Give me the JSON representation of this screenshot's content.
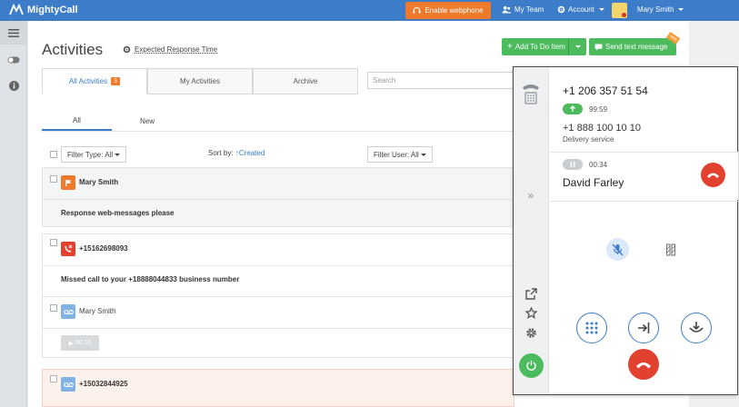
{
  "app": {
    "name": "MightyCall"
  },
  "topbar": {
    "webphone_label": "Enable webphone",
    "my_team_label": "My Team",
    "account_label": "Account",
    "user_name": "Mary Smith"
  },
  "page": {
    "title": "Activities",
    "expected_response_label": "Expected Response Time"
  },
  "actions": {
    "add_todo_label": "Add To Do Item",
    "send_text_label": "Send text message",
    "new_tag": "new"
  },
  "tabs": [
    {
      "label": "All Activities",
      "badge": "3"
    },
    {
      "label": "My Activities"
    },
    {
      "label": "Archive"
    }
  ],
  "search": {
    "placeholder": "Search"
  },
  "subtabs": [
    {
      "label": "All"
    },
    {
      "label": "New"
    }
  ],
  "filters": {
    "type_label": "Filter Type: All",
    "sort_label": "Sort by:",
    "sort_value": "Created",
    "user_label": "Filter User: All"
  },
  "activities": [
    {
      "name": "Mary Smith",
      "text": "Response web-messages please"
    },
    {
      "name": "+15162698093",
      "text": "Missed call to your +18888044833 business number"
    },
    {
      "name": "Mary Smith",
      "duration": "00:10"
    },
    {
      "name": "+15032844925"
    }
  ],
  "phone": {
    "main_number": "+1 206 357 51 54",
    "active_timer": "99:59",
    "business_number": "+1 888 100 10 10",
    "service": "Delivery service",
    "hold_timer": "00:34",
    "held_caller": "David Farley"
  },
  "colors": {
    "topbar": "#3d7cc9",
    "orange": "#f07a2c",
    "green": "#4cbb5e",
    "red": "#e2412f",
    "blue": "#3d7cc9"
  }
}
